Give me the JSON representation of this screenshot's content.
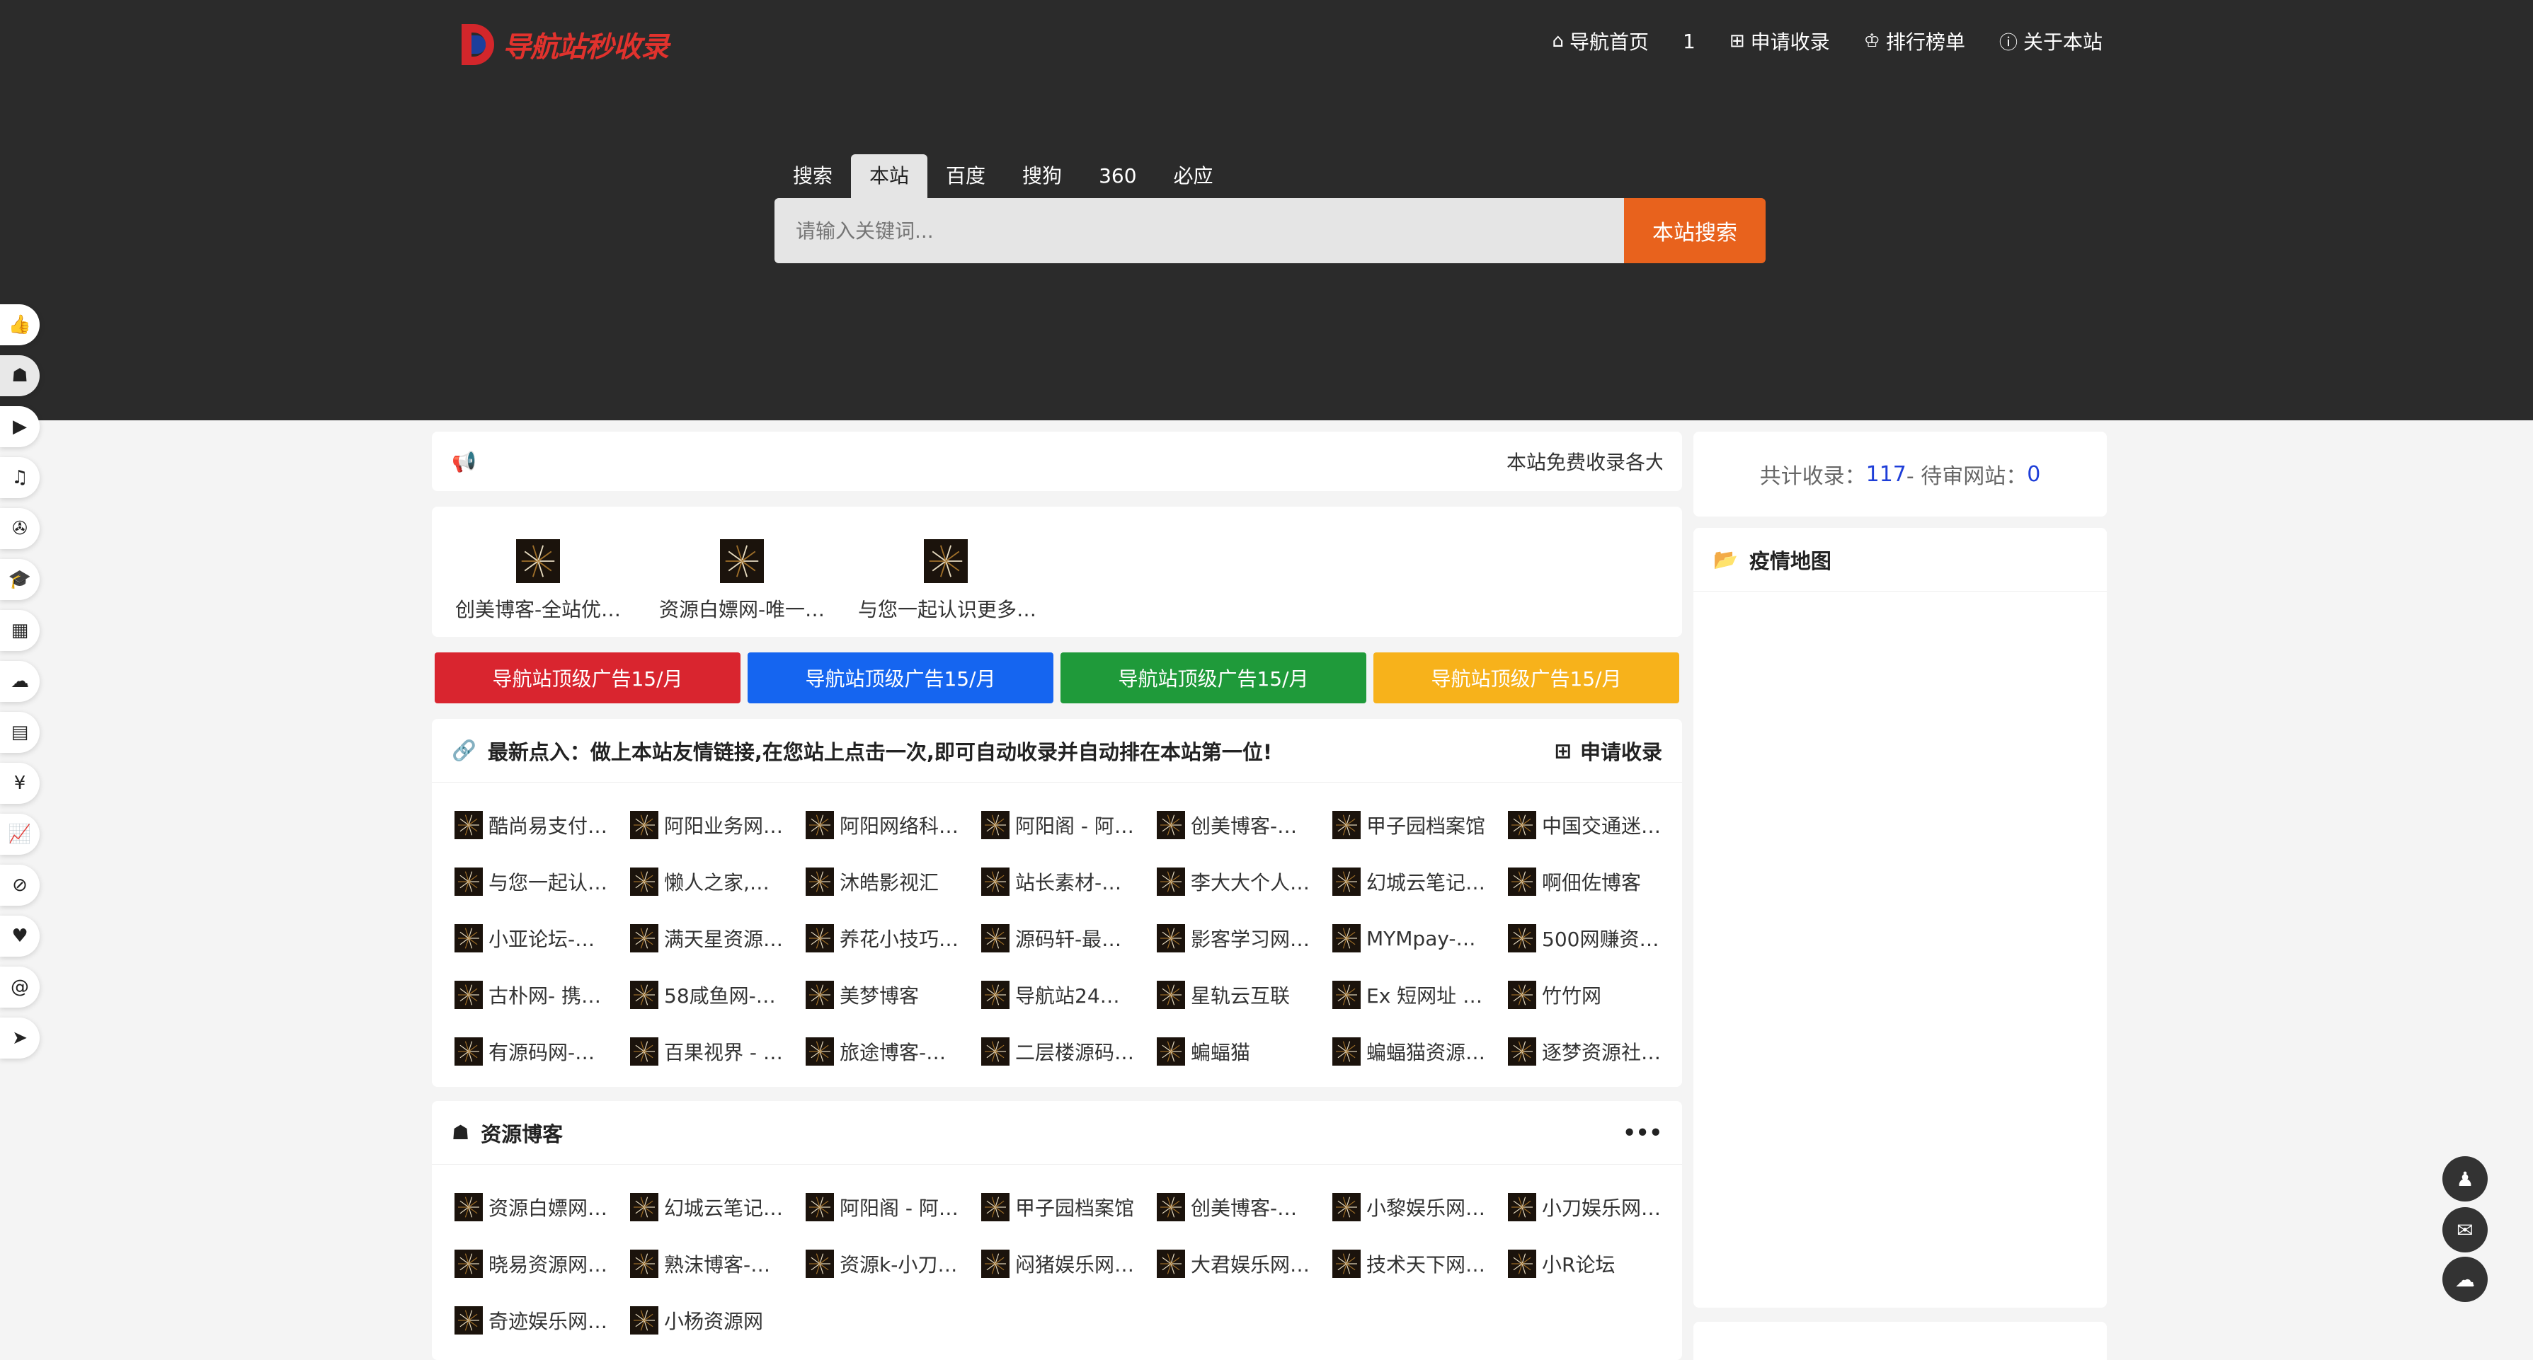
{
  "brand": {
    "name": "导航站秒收录",
    "colors": {
      "red": "#d3262b",
      "blue": "#1d3f9c"
    }
  },
  "nav": [
    {
      "icon": "home-icon",
      "glyph": "⌂",
      "label": "导航首页"
    },
    {
      "icon": "",
      "glyph": "",
      "label": "1"
    },
    {
      "icon": "plus-square-icon",
      "glyph": "⊞",
      "label": "申请收录"
    },
    {
      "icon": "trophy-icon",
      "glyph": "♔",
      "label": "排行榜单"
    },
    {
      "icon": "info-icon",
      "glyph": "ⓘ",
      "label": "关于本站"
    }
  ],
  "search": {
    "tabs": [
      "搜索",
      "本站",
      "百度",
      "搜狗",
      "360",
      "必应"
    ],
    "active_tab": "本站",
    "placeholder": "请输入关键词...",
    "button": "本站搜索",
    "button_color": "#e8621d"
  },
  "rail_icons": [
    "thumbs-up-icon",
    "blog-icon",
    "video-icon",
    "music-icon",
    "game-icon",
    "graduation-icon",
    "grid-icon",
    "cloud-icon",
    "document-icon",
    "yuan-icon",
    "chart-icon",
    "compass-icon",
    "health-icon",
    "spiral-icon",
    "send-icon"
  ],
  "notice": {
    "icon": "megaphone-icon",
    "text": "本站免费收录各大"
  },
  "featured": [
    "创美博客-全站优…",
    "资源白嫖网-唯一…",
    "与您一起认识更多…"
  ],
  "ads": [
    {
      "label": "导航站顶级广告15/月",
      "color": "#d9252f"
    },
    {
      "label": "导航站顶级广告15/月",
      "color": "#1565f0"
    },
    {
      "label": "导航站顶级广告15/月",
      "color": "#1f9a3a"
    },
    {
      "label": "导航站顶级广告15/月",
      "color": "#f7b21b"
    }
  ],
  "latest": {
    "title": "最新点入：做上本站友情链接,在您站上点击一次,即可自动收录并自动排在本站第一位!",
    "action": "申请收录",
    "links": [
      "酷尚易支付…",
      "阿阳业务网…",
      "阿阳网络科…",
      "阿阳阁 - 阿…",
      "创美博客-…",
      "甲子园档案馆",
      "中国交通迷…",
      "与您一起认…",
      "懒人之家,…",
      "沐皓影视汇",
      "站长素材-…",
      "李大大个人…",
      "幻城云笔记…",
      "啊佃佐博客",
      "小亚论坛-…",
      "满天星资源…",
      "养花小技巧…",
      "源码轩-最…",
      "影客学习网…",
      "MYMpay-…",
      "500网赚资…",
      "古朴网- 携…",
      "58咸鱼网-…",
      "美梦博客",
      "导航站24…",
      "星轨云互联",
      "Ex 短网址 …",
      "竹竹网",
      "有源码网-…",
      "百果视界 - …",
      "旅途博客-…",
      "二层楼源码…",
      "蝙蝠猫",
      "蝙蝠猫资源…",
      "逐梦资源社…"
    ]
  },
  "blog": {
    "title": "资源博客",
    "more": "•••",
    "links": [
      "资源白嫖网…",
      "幻城云笔记…",
      "阿阳阁 - 阿…",
      "甲子园档案馆",
      "创美博客-…",
      "小黎娱乐网…",
      "小刀娱乐网…",
      "晓易资源网…",
      "熟沫博客-…",
      "资源k-小刀…",
      "闷猪娱乐网…",
      "大君娱乐网…",
      "技术天下网…",
      "小R论坛",
      "奇迹娱乐网…",
      "小杨资源网"
    ]
  },
  "stats": {
    "label1": "共计收录：",
    "count": "117",
    "sep": " - 待审网站：",
    "pending": "0"
  },
  "map": {
    "title": "疫情地图"
  },
  "float_buttons": [
    "qq-icon",
    "mail-icon",
    "wechat-icon"
  ]
}
